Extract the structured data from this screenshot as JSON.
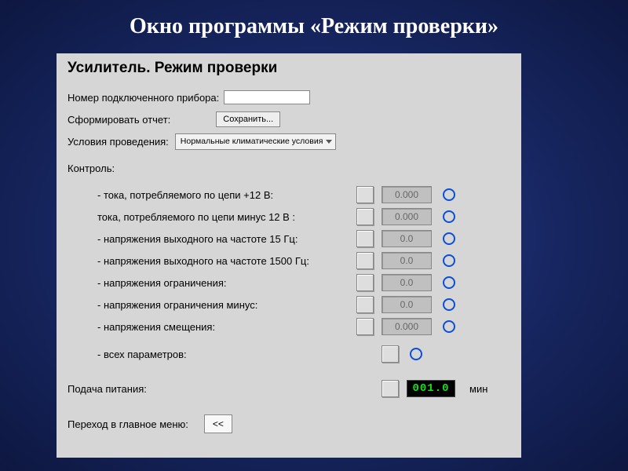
{
  "slide": {
    "title": "Окно программы «Режим проверки»"
  },
  "panel": {
    "heading": "Усилитель. Режим проверки",
    "device_num_label": "Номер подключенного прибора:",
    "device_num_value": "",
    "report_label": "Сформировать отчет:",
    "save_btn": "Сохранить...",
    "conditions_label": "Условия проведения:",
    "conditions_selected": "Нормальные климатические условия",
    "control_label": "Контроль:",
    "controls": [
      {
        "label": "- тока, потребляемого по цепи +12 В:",
        "value": "0.000"
      },
      {
        "label": "тока, потребляемого по цепи минус 12 В :",
        "value": "0.000"
      },
      {
        "label": "- напряжения выходного на частоте 15 Гц:",
        "value": "0.0"
      },
      {
        "label": "- напряжения выходного на частоте 1500 Гц:",
        "value": "0.0"
      },
      {
        "label": "- напряжения ограничения:",
        "value": "0.0"
      },
      {
        "label": "- напряжения ограничения минус:",
        "value": "0.0"
      },
      {
        "label": "- напряжения смещения:",
        "value": "0.000"
      }
    ],
    "all_params_label": "- всех параметров:",
    "power_label": "Подача питания:",
    "timer_value": "001.0",
    "timer_unit": "мин",
    "back_label": "Переход в главное меню:",
    "back_btn": "<<"
  }
}
